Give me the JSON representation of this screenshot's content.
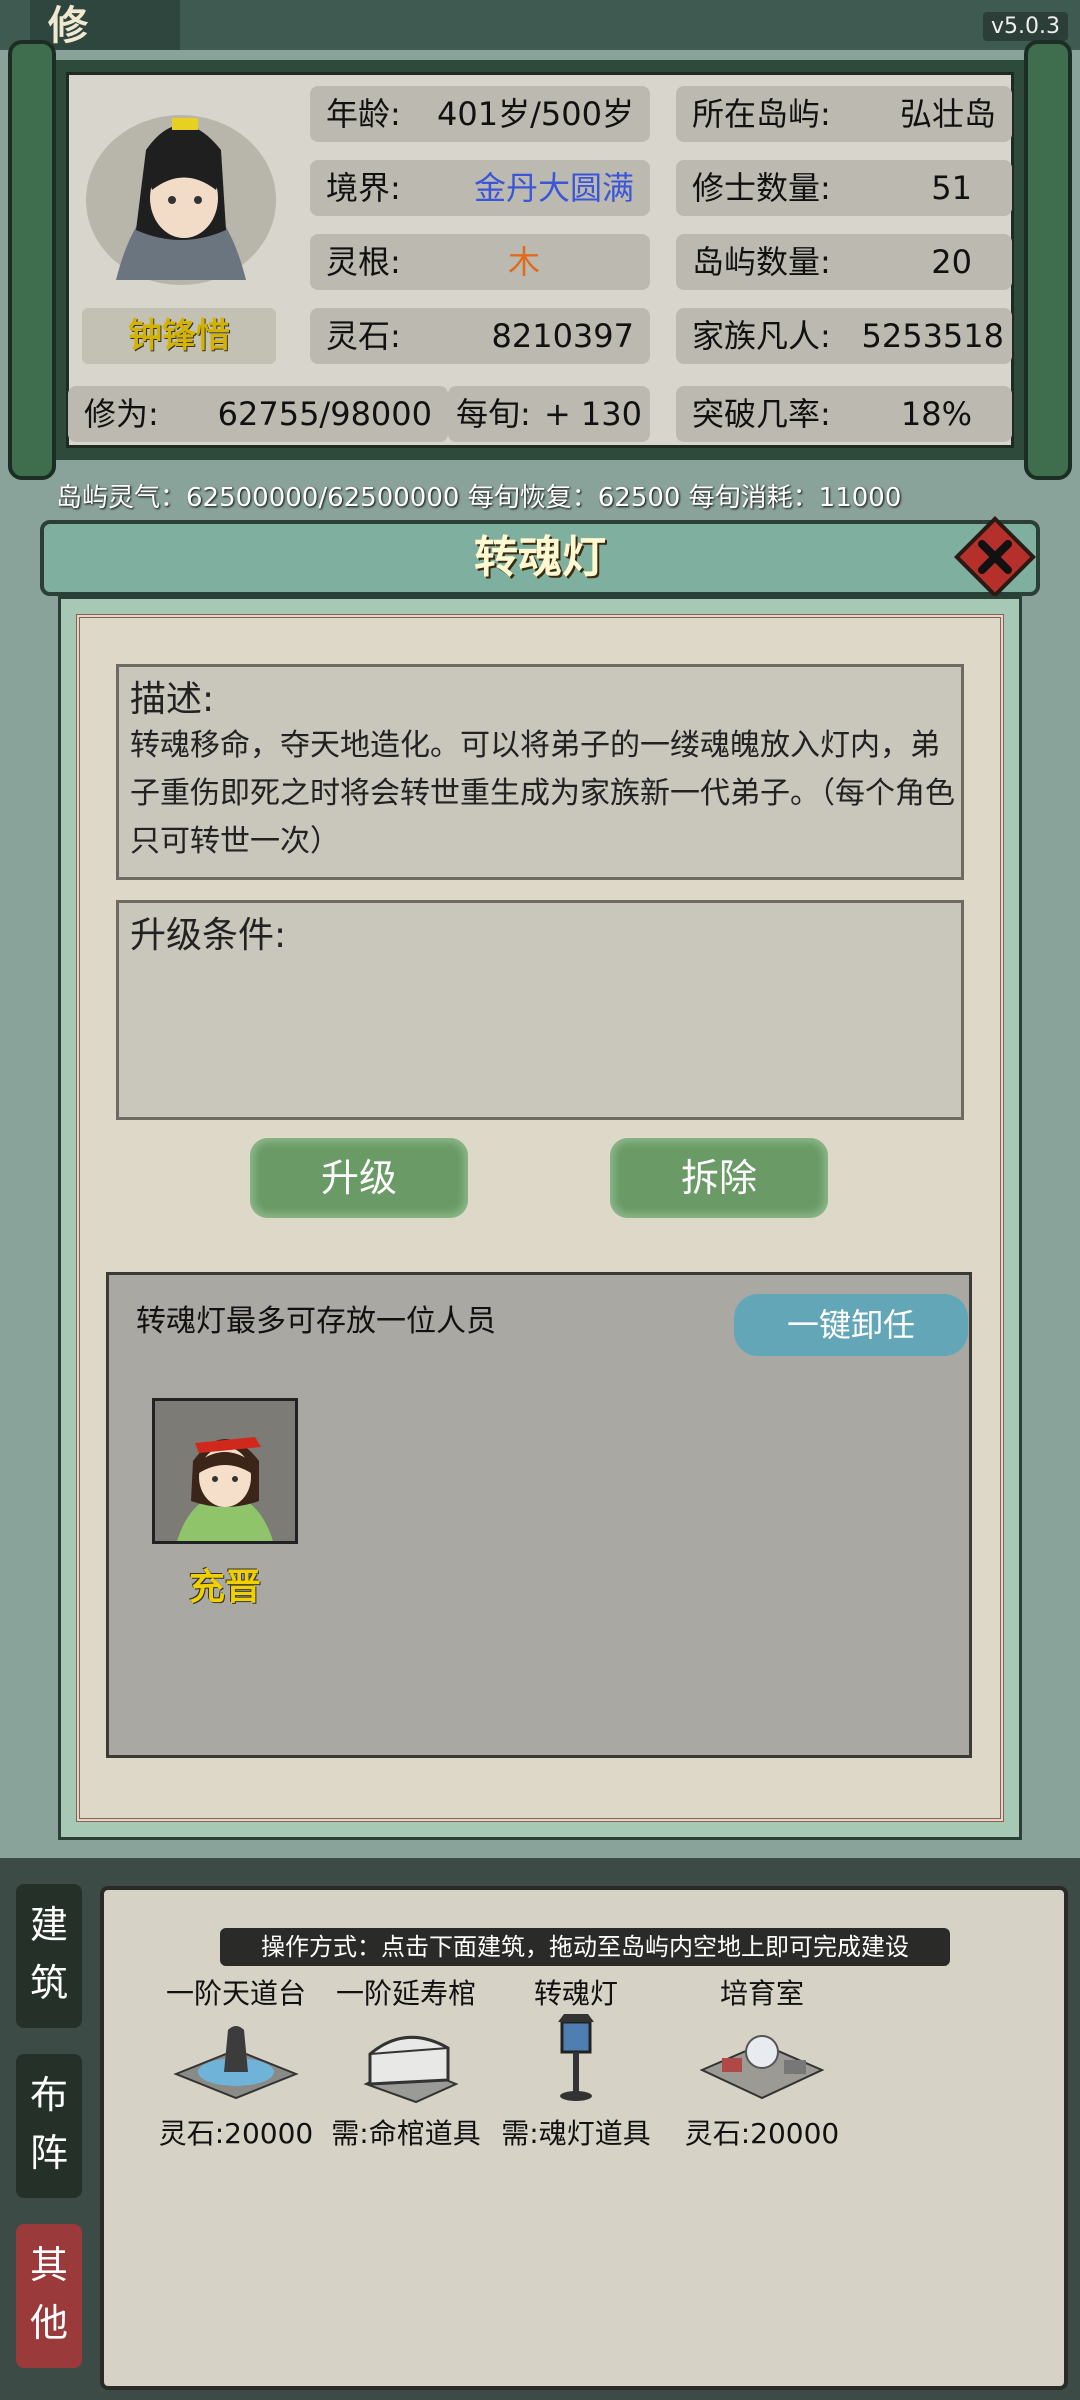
{
  "app": {
    "title_char": "修",
    "version": "v5.0.3"
  },
  "player": {
    "name": "钟锋惜",
    "age": {
      "label": "年龄:",
      "value": "401岁/500岁"
    },
    "realm": {
      "label": "境界:",
      "value": "金丹大圆满"
    },
    "root": {
      "label": "灵根:",
      "value": "木"
    },
    "stone": {
      "label": "灵石:",
      "value": "8210397"
    },
    "cultivation": {
      "label": "修为:",
      "value": "62755/98000"
    },
    "per_turn": {
      "label": "每旬:",
      "value": "+ 130"
    },
    "island": {
      "label": "所在岛屿:",
      "value": "弘壮岛"
    },
    "cultivators": {
      "label": "修士数量:",
      "value": "51"
    },
    "islands": {
      "label": "岛屿数量:",
      "value": "20"
    },
    "mortals": {
      "label": "家族凡人:",
      "value": "5253518"
    },
    "breakthrough": {
      "label": "突破几率:",
      "value": "18%"
    }
  },
  "island_qi": "岛屿灵气：62500000/62500000 每旬恢复：62500  每旬消耗：11000",
  "dialog": {
    "title": "转魂灯",
    "desc_title": "描述:",
    "desc_text": "转魂移命，夺天地造化。可以将弟子的一缕魂魄放入灯内，弟子重伤即死之时将会转世重生成为家族新一代弟子。（每个角色只可转世一次）",
    "upgrade_title": "升级条件:",
    "upgrade_button": "升级",
    "remove_button": "拆除",
    "storage_text": "转魂灯最多可存放一位人员",
    "unload_button": "一键卸任",
    "member_name": "充晋"
  },
  "build_panel": {
    "tabs": [
      "建筑",
      "布阵",
      "其他"
    ],
    "hint": "操作方式：点击下面建筑，拖动至岛屿内空地上即可完成建设",
    "buildings": [
      {
        "name": "一阶天道台",
        "cost": "灵石:20000"
      },
      {
        "name": "一阶延寿棺",
        "cost": "需:命棺道具"
      },
      {
        "name": "转魂灯",
        "cost": "需:魂灯道具"
      },
      {
        "name": "培育室",
        "cost": "灵石:20000"
      }
    ]
  },
  "colors": {
    "accent_green": "#6a9a66",
    "realm_blue": "#3b57d8",
    "root_orange": "#e06b1c",
    "name_gold": "#d4b200"
  }
}
